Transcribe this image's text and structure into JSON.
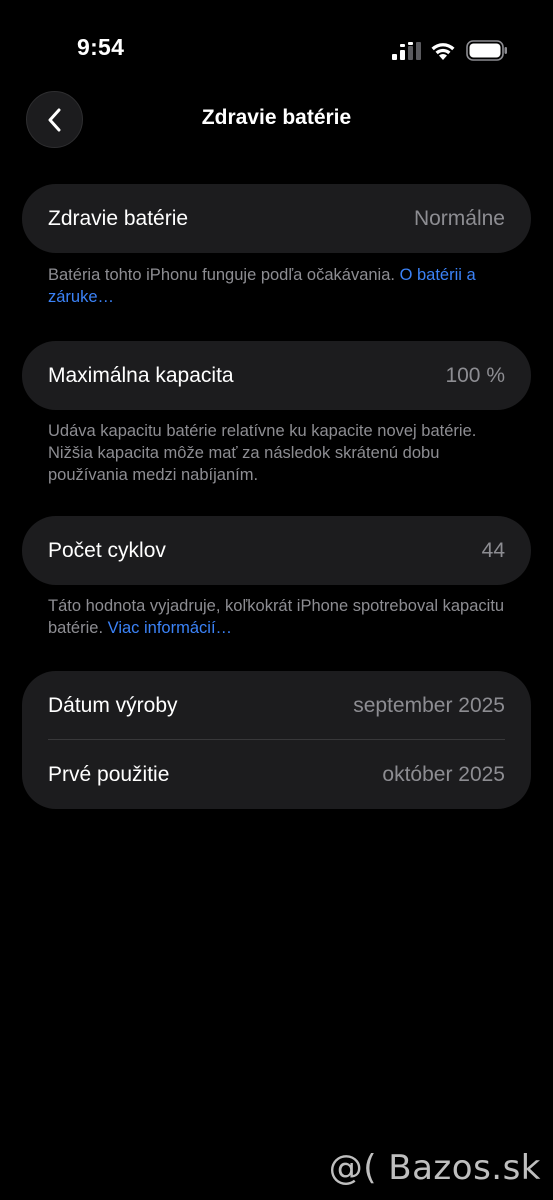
{
  "status_bar": {
    "time": "9:54",
    "icons": [
      "cellular-signal-icon",
      "wifi-icon",
      "battery-icon"
    ]
  },
  "nav": {
    "back_icon": "chevron-left-icon",
    "title": "Zdravie batérie"
  },
  "battery_health": {
    "label": "Zdravie batérie",
    "value": "Normálne",
    "footnote_text": "Batéria tohto iPhonu funguje podľa očakávania. ",
    "footnote_link": "O batérii a záruke…"
  },
  "max_capacity": {
    "label": "Maximálna kapacita",
    "value": "100 %",
    "footnote_text": "Udáva kapacitu batérie relatívne ku kapacite novej batérie. Nižšia kapacita môže mať za následok skrátenú dobu používania medzi nabíjaním."
  },
  "cycle_count": {
    "label": "Počet cyklov",
    "value": "44",
    "footnote_text": "Táto hodnota vyjadruje, koľkokrát iPhone spotreboval kapacitu batérie. ",
    "footnote_link": "Viac informácií…"
  },
  "dates": {
    "manufacture_label": "Dátum výroby",
    "manufacture_value": "september 2025",
    "first_use_label": "Prvé použitie",
    "first_use_value": "október 2025"
  },
  "watermark": "@( Bazos.sk",
  "colors": {
    "background": "#000000",
    "card": "#1c1c1e",
    "secondary_text": "#8d8d92",
    "link": "#3b82f6"
  }
}
